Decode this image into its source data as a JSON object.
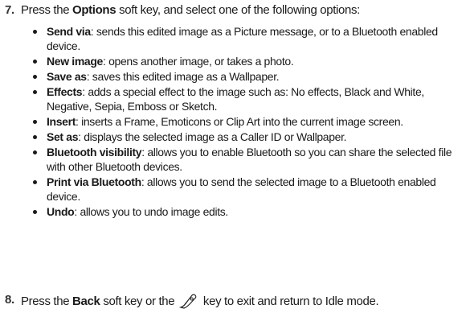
{
  "step7": {
    "number": "7.",
    "text_before": "Press the ",
    "key": "Options",
    "text_after": " soft key, and select one of the following options:"
  },
  "options": [
    {
      "term": "Send via",
      "desc": ": sends this edited image as a Picture message, or to a Bluetooth enabled device."
    },
    {
      "term": "New image",
      "desc": ": opens another image, or takes a photo."
    },
    {
      "term": "Save as",
      "desc": ": saves this edited image as a Wallpaper."
    },
    {
      "term": "Effects",
      "desc": ": adds a special effect to the image such as: No effects, Black and White, Negative, Sepia, Emboss or Sketch."
    },
    {
      "term": "Insert",
      "desc": ": inserts a Frame, Emoticons or Clip Art into the current image screen."
    },
    {
      "term": "Set as",
      "desc": ": displays the selected image as a Caller ID or Wallpaper."
    },
    {
      "term": "Bluetooth visibility",
      "desc": ": allows you to enable Bluetooth so you can share the selected file with other Bluetooth devices."
    },
    {
      "term": "Print via Bluetooth",
      "desc": ": allows you to send the selected image to a Bluetooth enabled device."
    },
    {
      "term": "Undo",
      "desc": ": allows you to undo image edits."
    }
  ],
  "step8": {
    "number": "8.",
    "text_before": "Press the ",
    "key": "Back",
    "text_middle": " soft key or the ",
    "icon": "end-key-icon",
    "text_after": " key to exit and return to Idle mode."
  }
}
